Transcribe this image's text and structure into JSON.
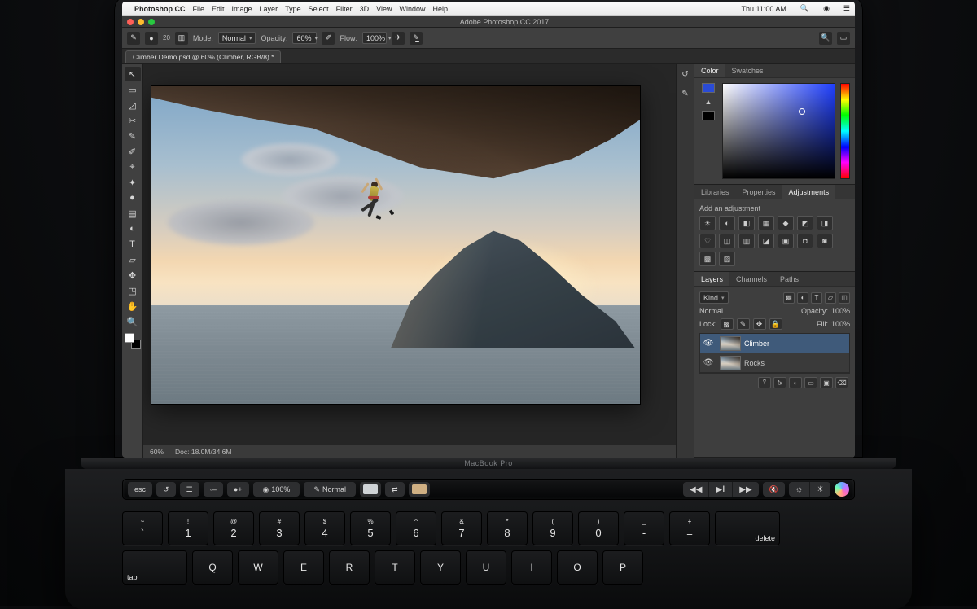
{
  "mac_menu": {
    "app_name": "Photoshop CC",
    "items": [
      "File",
      "Edit",
      "Image",
      "Layer",
      "Type",
      "Select",
      "Filter",
      "3D",
      "View",
      "Window",
      "Help"
    ],
    "clock": "Thu 11:00 AM"
  },
  "app": {
    "title": "Adobe Photoshop CC 2017",
    "document_tab": "Climber Demo.psd @ 60% (Climber, RGB/8) *"
  },
  "options_bar": {
    "mode_label": "Mode:",
    "mode_value": "Normal",
    "opacity_label": "Opacity:",
    "opacity_value": "60%",
    "flow_label": "Flow:",
    "flow_value": "100%",
    "brush_size": "20"
  },
  "tools": [
    "↖",
    "▭",
    "◿",
    "✂",
    "✎",
    "✐",
    "⌖",
    "✦",
    "●",
    "▤",
    "◐",
    "T",
    "▱",
    "✥",
    "◳",
    "✋",
    "🔍"
  ],
  "status_bar": {
    "zoom": "60%",
    "doc_info": "Doc: 18.0M/34.6M"
  },
  "panels": {
    "color_tabs": [
      "Color",
      "Swatches"
    ],
    "lib_tabs": [
      "Libraries",
      "Properties",
      "Adjustments"
    ],
    "adjustments_label": "Add an adjustment",
    "adjustments_icons": [
      "☀",
      "◐",
      "◧",
      "▦",
      "◆",
      "◩",
      "◨",
      "♡",
      "◫",
      "▥",
      "◪",
      "▣",
      "◘",
      "◙",
      "▩",
      "▧"
    ],
    "layers_tabs": [
      "Layers",
      "Channels",
      "Paths"
    ],
    "layer_kind": "Kind",
    "blend_mode": "Normal",
    "layer_opacity_label": "Opacity:",
    "layer_opacity_value": "100%",
    "lock_label": "Lock:",
    "fill_label": "Fill:",
    "fill_value": "100%",
    "layers": [
      {
        "name": "Climber",
        "visible": true,
        "selected": true
      },
      {
        "name": "Rocks",
        "visible": true,
        "selected": false
      }
    ],
    "layer_footer_icons": [
      "⍢",
      "fx",
      "◐",
      "▭",
      "▣",
      "⌫"
    ]
  },
  "touchbar": {
    "esc": "esc",
    "history": "↺",
    "layers": "☰",
    "brush_minus": "◦–",
    "brush_plus": "●+",
    "size_value": "100%",
    "mode_value": "Normal",
    "color_a": "#cfd3d6",
    "color_b": "#d0b083",
    "controls": [
      "◀◀",
      "▶‖",
      "▶▶"
    ],
    "mute": "🔇",
    "bright_lo": "☼",
    "bright_hi": "☀"
  },
  "keyboard": {
    "row_num_syms": [
      "~",
      "!",
      "@",
      "#",
      "$",
      "%",
      "^",
      "&",
      "*",
      "(",
      ")",
      "_",
      "+"
    ],
    "row_num_keys": [
      "`",
      "1",
      "2",
      "3",
      "4",
      "5",
      "6",
      "7",
      "8",
      "9",
      "0",
      "-",
      "="
    ],
    "delete": "delete",
    "tab": "tab",
    "row_qwerty": [
      "Q",
      "W",
      "E",
      "R",
      "T",
      "Y",
      "U",
      "I",
      "O",
      "P"
    ]
  },
  "hinge_label": "MacBook Pro"
}
